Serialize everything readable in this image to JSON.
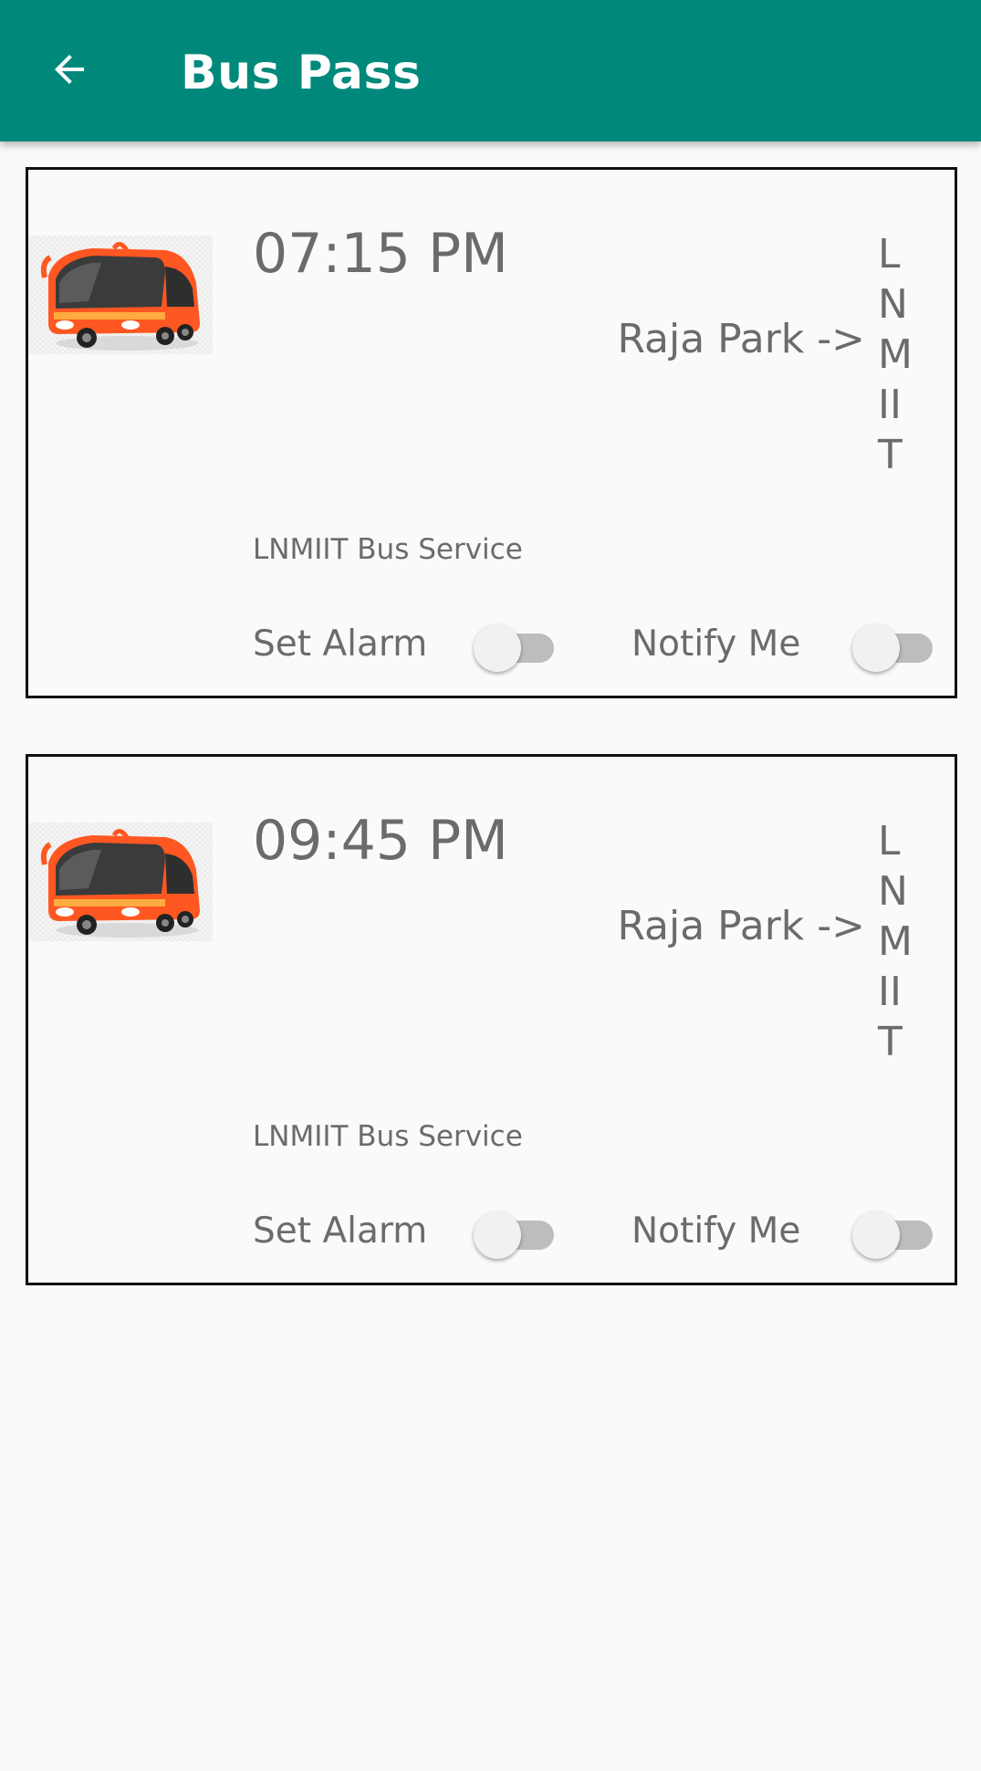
{
  "appbar": {
    "title": "Bus Pass",
    "background": "#00897b",
    "back_icon": "arrow-back-icon"
  },
  "buses": [
    {
      "time": "07:15 PM",
      "route_from": "Raja Park ->",
      "route_to": "LNMIIT",
      "service": "LNMIIT Bus Service",
      "alarm_label": "Set Alarm",
      "alarm_on": false,
      "notify_label": "Notify Me",
      "notify_on": false,
      "image": "bus-icon"
    },
    {
      "time": "09:45 PM",
      "route_from": "Raja Park ->",
      "route_to": "LNMIIT",
      "service": "LNMIIT Bus Service",
      "alarm_label": "Set Alarm",
      "alarm_on": false,
      "notify_label": "Notify Me",
      "notify_on": false,
      "image": "bus-icon"
    }
  ],
  "colors": {
    "bus_body": "#ff5722",
    "text_secondary": "#6b6b6b",
    "switch_off_track": "#bdbdbd"
  }
}
